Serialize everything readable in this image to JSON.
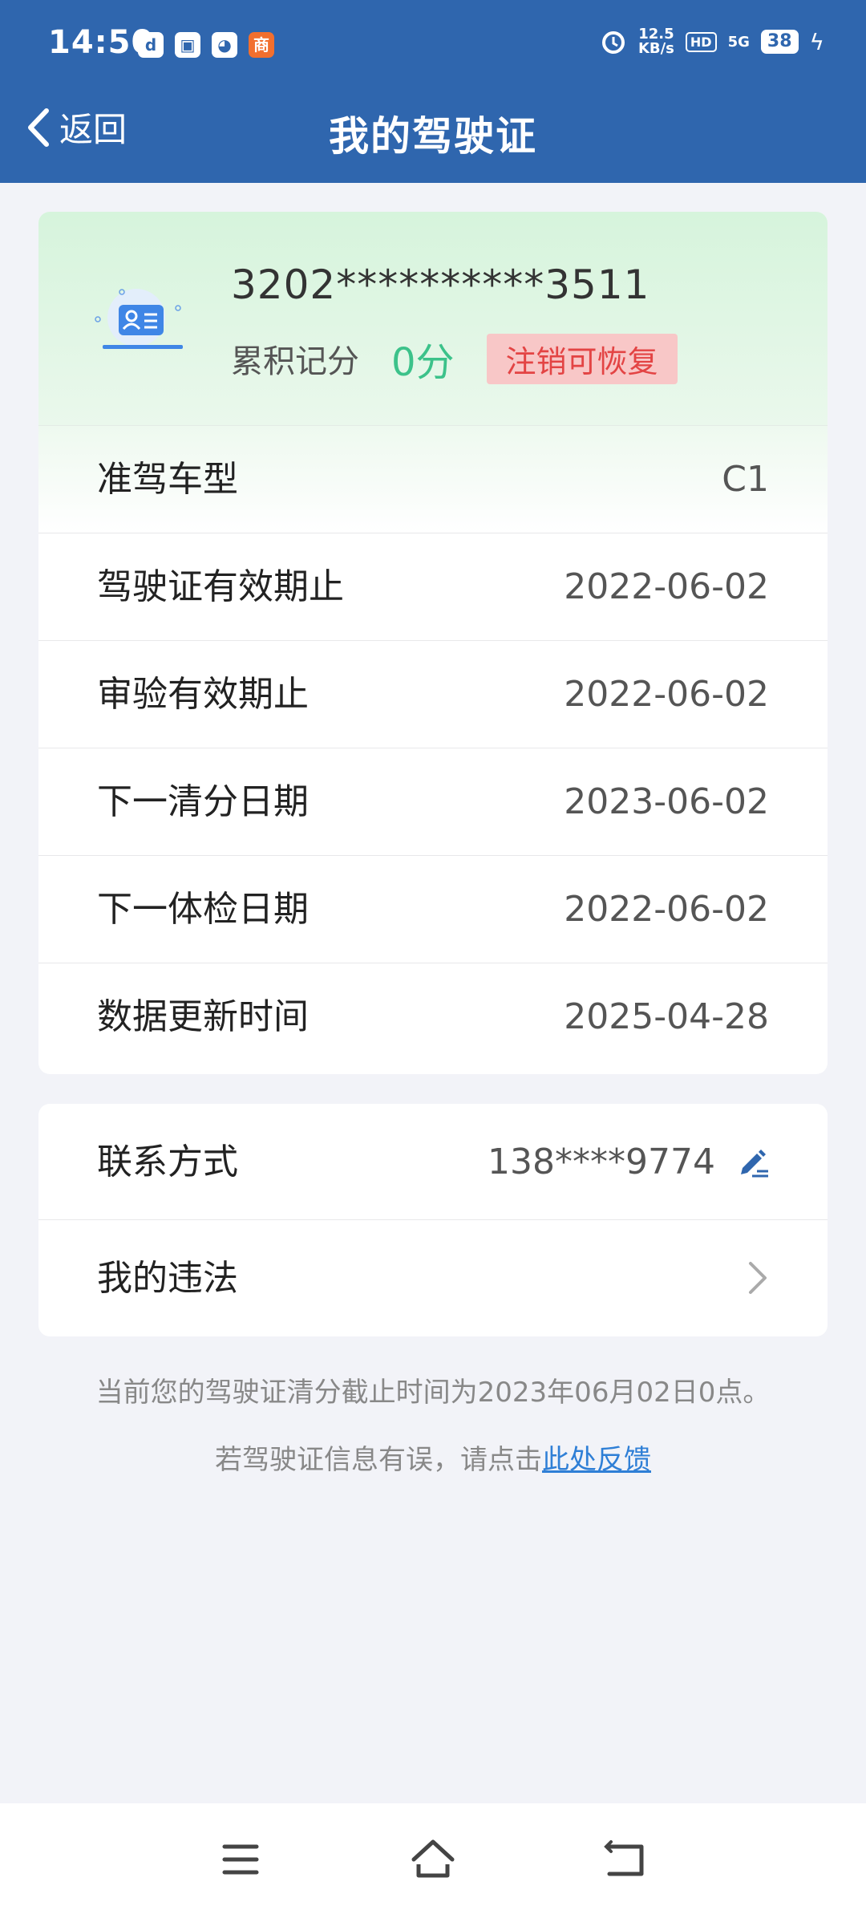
{
  "status_bar": {
    "time": "14:50",
    "app_icons": [
      "d",
      "▣",
      "◕",
      "商"
    ],
    "speed_top": "12.5",
    "speed_bottom": "KB/s",
    "hd": "HD",
    "signal": "5G",
    "battery": "38"
  },
  "header": {
    "back_label": "返回",
    "title": "我的驾驶证"
  },
  "license": {
    "number": "3202**********3511",
    "points_label": "累积记分",
    "points_value": "0分",
    "status": "注销可恢复"
  },
  "details": [
    {
      "label": "准驾车型",
      "value": "C1"
    },
    {
      "label": "驾驶证有效期止",
      "value": "2022-06-02"
    },
    {
      "label": "审验有效期止",
      "value": "2022-06-02"
    },
    {
      "label": "下一清分日期",
      "value": "2023-06-02"
    },
    {
      "label": "下一体检日期",
      "value": "2022-06-02"
    },
    {
      "label": "数据更新时间",
      "value": "2025-04-28"
    }
  ],
  "contact": {
    "label": "联系方式",
    "value": "138****9774"
  },
  "violations": {
    "label": "我的违法"
  },
  "notices": {
    "line1": "当前您的驾驶证清分截止时间为2023年06月02日0点。",
    "line2_prefix": "若驾驶证信息有误，请点击",
    "line2_link": "此处反馈"
  },
  "colors": {
    "header": "#2f66ae",
    "points": "#3cc28a",
    "badge_text": "#e34444",
    "link": "#2f7fd6"
  },
  "icons": {
    "back": "chevron-left-icon",
    "license": "license-card-icon",
    "edit": "edit-icon",
    "arrow": "chevron-right-icon",
    "menu": "menu-icon",
    "home": "home-icon",
    "back_nav": "back-icon"
  }
}
